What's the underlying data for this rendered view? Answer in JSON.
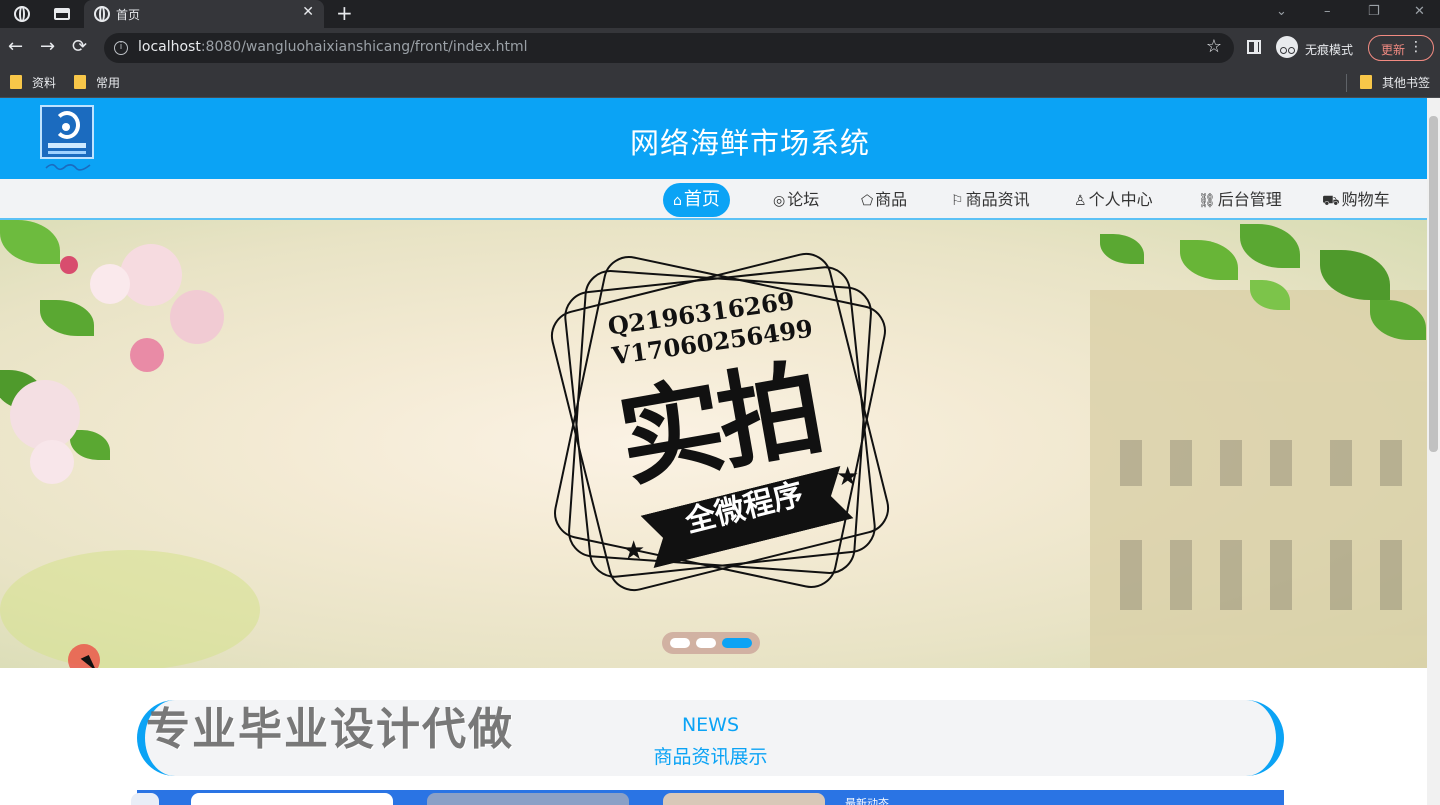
{
  "browser": {
    "tab_title": "首页",
    "tab_close": "✕",
    "new_tab": "+",
    "window_controls": [
      "⌄",
      "–",
      "❐",
      "✕"
    ],
    "url_host": "localhost",
    "url_rest": ":8080/wangluohaixianshicang/front/index.html",
    "star": "☆",
    "incognito_label": "无痕模式",
    "update_label": "更新",
    "menu_dots": "⋮",
    "bookmarks": [
      "资料",
      "常用"
    ],
    "other_bookmarks": "其他书签",
    "nav": {
      "back": "←",
      "forward": "→",
      "reload": "⟳"
    }
  },
  "site": {
    "title": "网络海鲜市场系统",
    "nav": [
      {
        "label": "首页",
        "icon": "home-icon",
        "glyph": "⌂"
      },
      {
        "label": "论坛",
        "icon": "globe-icon",
        "glyph": "◎"
      },
      {
        "label": "商品",
        "icon": "tag-icon",
        "glyph": "⬠"
      },
      {
        "label": "商品资讯",
        "icon": "flag-icon",
        "glyph": "⚐"
      },
      {
        "label": "个人中心",
        "icon": "user-icon",
        "glyph": "♙"
      },
      {
        "label": "后台管理",
        "icon": "link-icon",
        "glyph": "⛓"
      },
      {
        "label": "购物车",
        "icon": "cart-icon",
        "glyph": "⛟"
      }
    ],
    "active_nav": "首页"
  },
  "banner": {
    "contact_q": "Q2196316269",
    "contact_v": "V17060256499",
    "headline": "实拍",
    "ribbon": "全微程序",
    "carousel": {
      "count": 3,
      "active": 3
    }
  },
  "news": {
    "en": "NEWS",
    "cn": "商品资讯展示",
    "watermark": "专业毕业设计代做",
    "peek_caption": "最新动态"
  },
  "colors": {
    "primary": "#0ba3f5",
    "chrome_dark": "#202124",
    "chrome": "#35363a",
    "update_accent": "#f28b82"
  }
}
